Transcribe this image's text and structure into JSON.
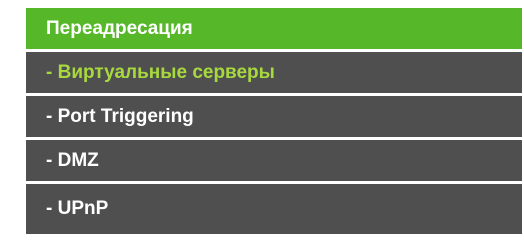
{
  "menu": {
    "header": "Переадресация",
    "items": [
      {
        "label": "- Виртуальные серверы"
      },
      {
        "label": "- Port Triggering"
      },
      {
        "label": "- DMZ"
      },
      {
        "label": "- UPnP"
      }
    ]
  },
  "colors": {
    "header_bg": "#56b829",
    "item_bg": "#4f4f4f",
    "item_text": "#ffffff",
    "active_text": "#a7d93f"
  }
}
